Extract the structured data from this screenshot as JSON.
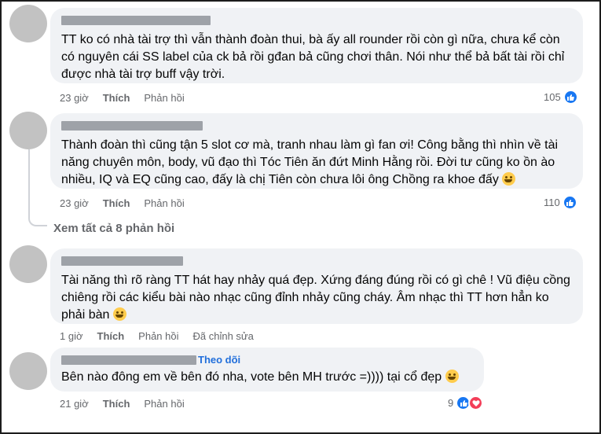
{
  "comments": [
    {
      "text": "TT ko có nhà tài trợ thì vẫn thành đoàn thui, bà ấy all rounder rồi còn gì nữa, chưa kể còn có nguyên cái SS label của ck bả rồi gđan bả cũng chơi thân. Nói như thể bả bất tài rồi chỉ được nhà tài trợ buff vậy trời.",
      "time": "23 giờ",
      "like": "Thích",
      "reply": "Phản hồi",
      "count": "105"
    },
    {
      "text": "Thành đoàn thì cũng tận 5 slot cơ mà, tranh nhau làm gì fan ơi! Công bằng thì nhìn về tài năng chuyên môn, body, vũ đạo thì Tóc Tiên ăn đứt Minh Hằng rồi. Đời tư cũng ko ồn ào nhiều, IQ và EQ cũng cao, đấy là chị Tiên còn chưa lôi ông Chồng ra khoe đấy",
      "time": "23 giờ",
      "like": "Thích",
      "reply": "Phản hồi",
      "count": "110"
    },
    {
      "text": "Tài năng thì rõ ràng TT hát hay nhảy quá đẹp. Xứng đáng đúng rồi có gì chê ! Vũ điệu cồng chiêng rồi các kiểu bài nào nhạc cũng đỉnh nhảy cũng cháy. Âm nhạc thì TT hơn hẳn ko phải bàn",
      "time": "1 giờ",
      "like": "Thích",
      "reply": "Phản hồi",
      "edited": "Đã chỉnh sửa"
    },
    {
      "follow": "Theo dõi",
      "text": "Bên nào đông em về bên đó nha, vote bên MH trước =)))) tại cổ đẹp",
      "time": "21 giờ",
      "like": "Thích",
      "reply": "Phản hồi",
      "count": "9"
    }
  ],
  "view_more": "Xem tất cả 8 phản hồi",
  "colors": {
    "like_blue": "#1877f2",
    "heart_red": "#f33e58",
    "bubble_bg": "#f0f2f5",
    "meta_gray": "#65676b"
  },
  "icons": [
    "like-icon",
    "heart-icon",
    "grin-emoji"
  ]
}
